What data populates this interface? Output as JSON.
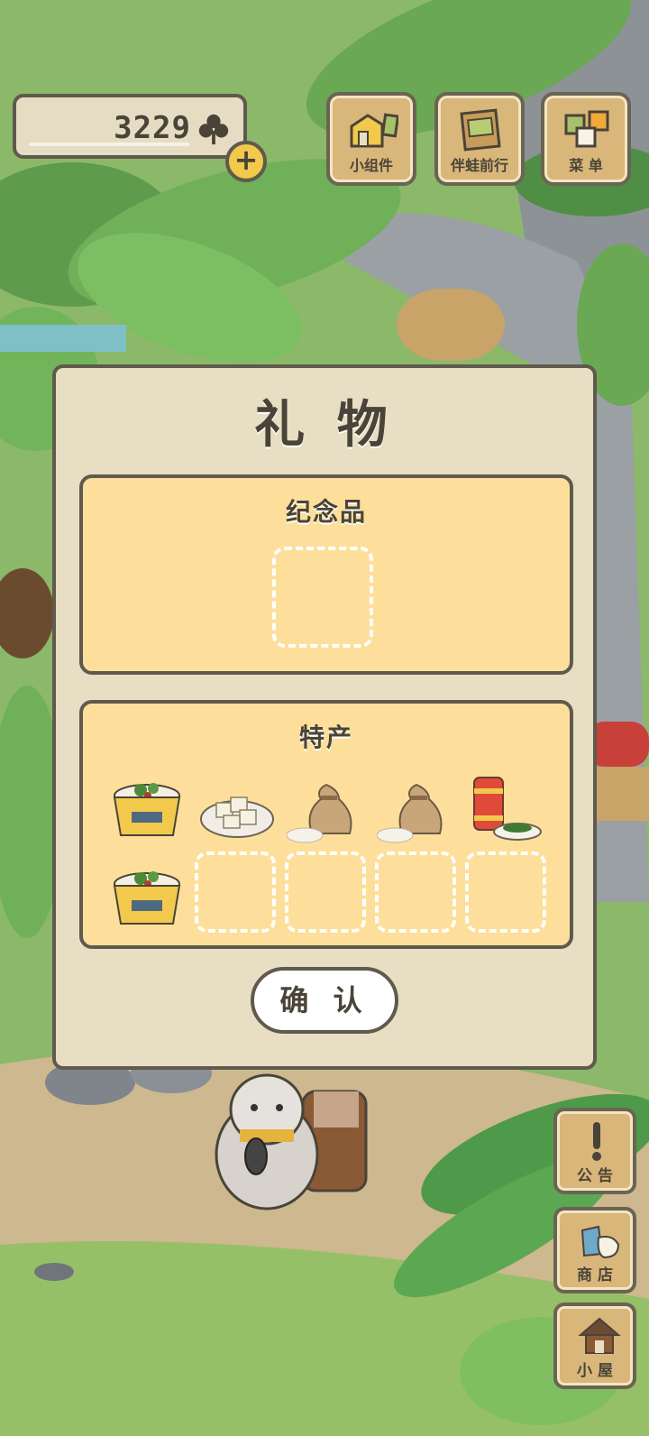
{
  "currency": {
    "clovers": "3229",
    "clover_icon": "clover-icon",
    "add_icon": "plus-icon",
    "add_label": "+"
  },
  "top_menu": [
    {
      "label": "小组件",
      "icon": "widget-icon"
    },
    {
      "label": "伴蛙前行",
      "icon": "album-icon"
    },
    {
      "label": "菜 单",
      "icon": "menu-icon"
    }
  ],
  "dialog": {
    "title": "礼 物",
    "souvenir": {
      "title": "纪念品",
      "slots": [
        "empty"
      ]
    },
    "specialty": {
      "title": "特产",
      "items": [
        {
          "icon": "noodle-bowl-icon"
        },
        {
          "icon": "tofu-plate-icon"
        },
        {
          "icon": "rice-sack-icon"
        },
        {
          "icon": "rice-sack-icon"
        },
        {
          "icon": "tea-can-icon"
        },
        {
          "icon": "noodle-bowl-icon"
        },
        {
          "icon": "empty"
        },
        {
          "icon": "empty"
        },
        {
          "icon": "empty"
        },
        {
          "icon": "empty"
        }
      ]
    },
    "confirm_label": "确 认"
  },
  "side_menu": [
    {
      "label": "公 告",
      "icon": "notice-icon"
    },
    {
      "label": "商 店",
      "icon": "shop-icon"
    },
    {
      "label": "小 屋",
      "icon": "house-icon"
    }
  ],
  "colors": {
    "dialog_bg": "#e8dec3",
    "panel_bg": "#fddf9b",
    "outline": "#5f5a4d",
    "button_wood": "#d9b67a"
  }
}
